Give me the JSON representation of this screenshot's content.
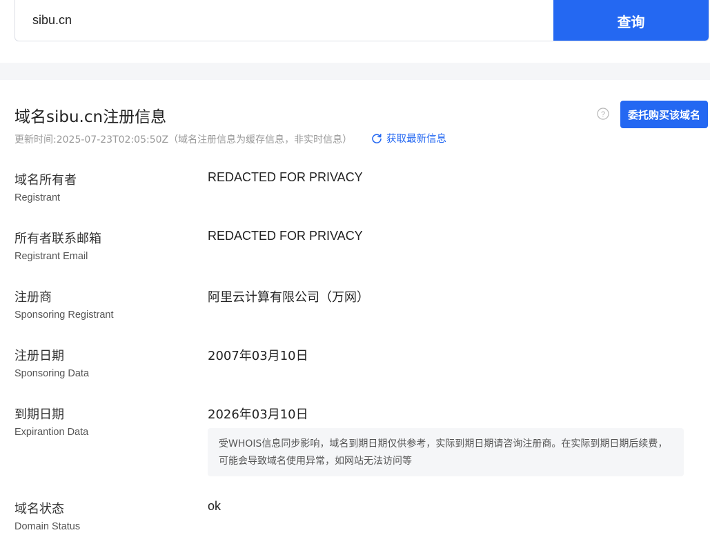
{
  "search": {
    "value": "sibu.cn",
    "button_label": "查询"
  },
  "header": {
    "title": "域名sibu.cn注册信息",
    "buy_button_label": "委托购买该域名",
    "update_text": "更新时间:2025-07-23T02:05:50Z（域名注册信息为缓存信息，非实时信息）",
    "refresh_label": "获取最新信息"
  },
  "rows": [
    {
      "label_cn": "域名所有者",
      "label_en": "Registrant",
      "value": "REDACTED FOR PRIVACY"
    },
    {
      "label_cn": "所有者联系邮箱",
      "label_en": "Registrant Email",
      "value": "REDACTED FOR PRIVACY"
    },
    {
      "label_cn": "注册商",
      "label_en": "Sponsoring Registrant",
      "value": "阿里云计算有限公司（万网）"
    },
    {
      "label_cn": "注册日期",
      "label_en": "Sponsoring Data",
      "value": "2007年03月10日"
    },
    {
      "label_cn": "到期日期",
      "label_en": "Expirantion Data",
      "value": "2026年03月10日"
    },
    {
      "label_cn": "域名状态",
      "label_en": "Domain Status",
      "value": "ok"
    }
  ],
  "notice": "受WHOIS信息同步影响，域名到期日期仅供参考，实际到期日期请咨询注册商。在实际到期日期后续费，可能会导致域名使用异常，如网站无法访问等",
  "icons": {
    "help": "help-circle-icon",
    "refresh": "refresh-icon"
  },
  "colors": {
    "accent": "#2468f2",
    "muted_text": "#999999",
    "band": "#f5f6f8"
  }
}
